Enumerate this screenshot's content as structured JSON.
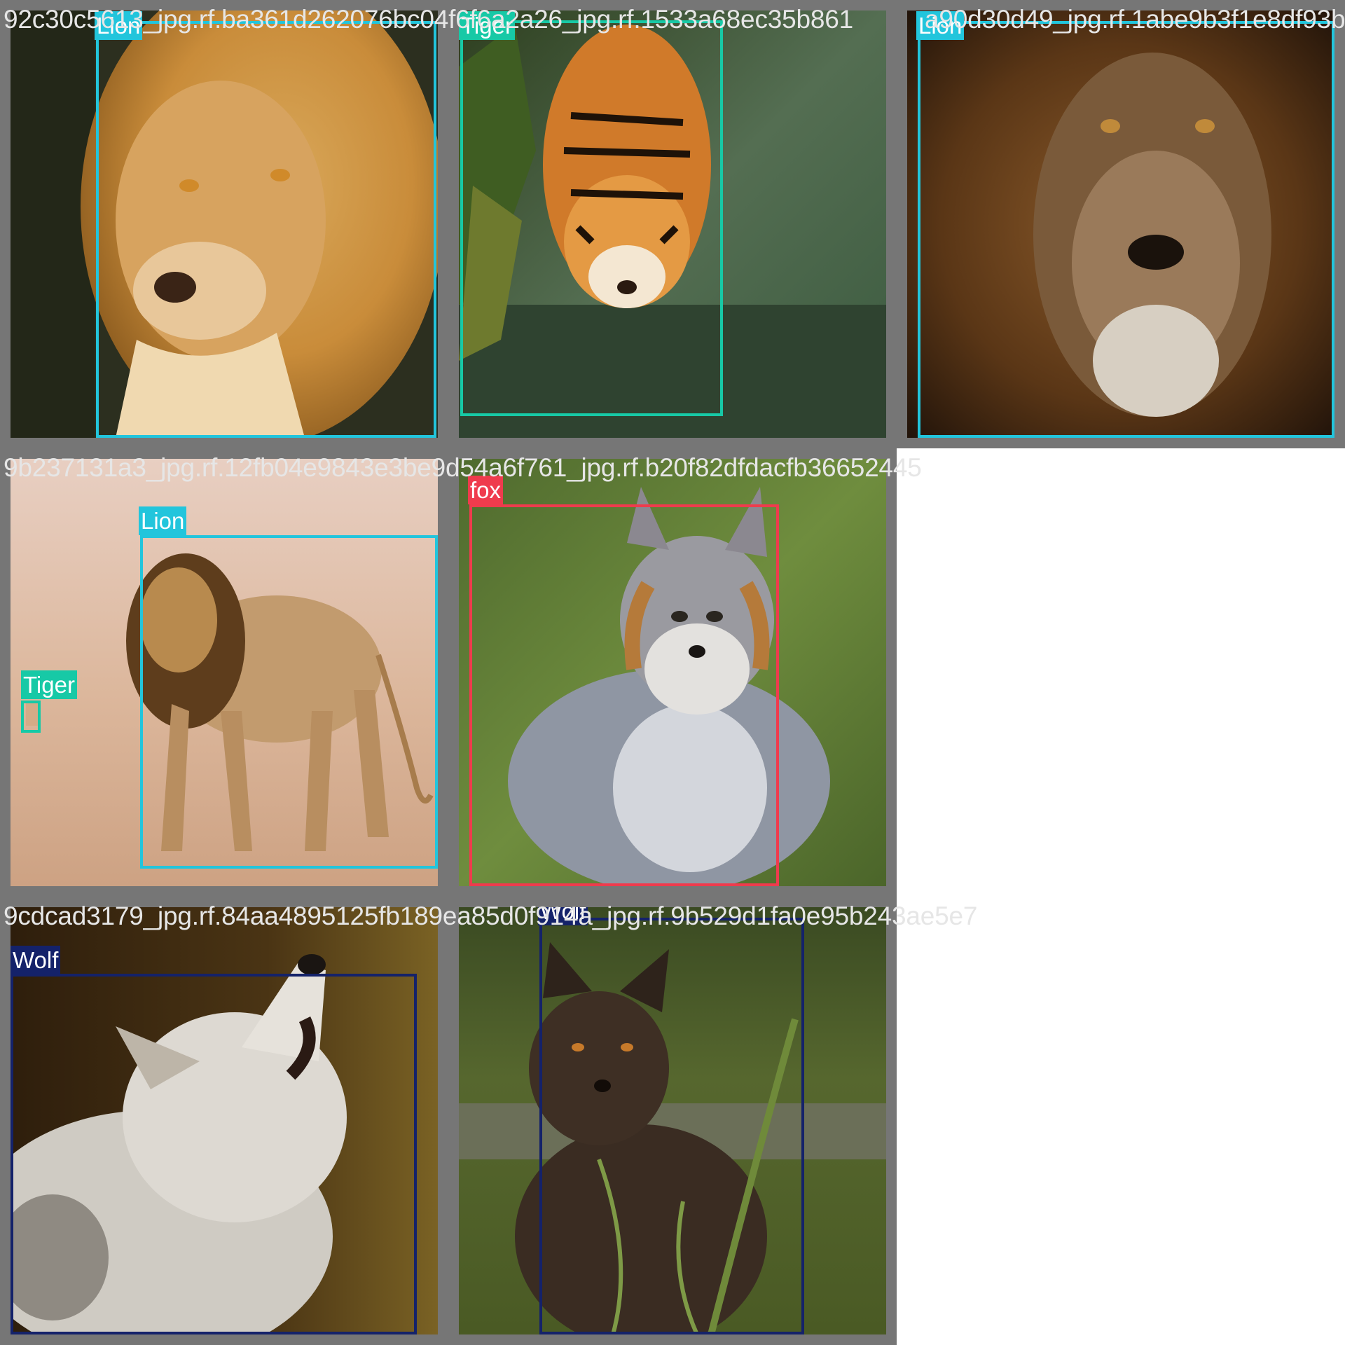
{
  "class_colors": {
    "Lion": "#22c5dc",
    "Tiger": "#17c9a6",
    "fox": "#ef3b4d",
    "Wolf": "#14226a"
  },
  "tiles": [
    {
      "filename": "92c30c5613_jpg.rf.ba361d262076bc04f6f6a2a26_jpg.rf.1533a68ec35b861",
      "scene": "lion-closeup",
      "boxes": [
        {
          "label": "Lion"
        }
      ]
    },
    {
      "filename": "",
      "scene": "tiger-stream",
      "boxes": [
        {
          "label": "Tiger"
        }
      ]
    },
    {
      "filename": "a90d30d49_jpg.rf.1abe9b3f1e8df93b",
      "scene": "lion-dark",
      "boxes": [
        {
          "label": "Lion"
        }
      ]
    },
    {
      "filename": "9b237131a3_jpg.rf.12fb04e9843e3be9d54a6f761_jpg.rf.b20f82dfdacfb36652445",
      "scene": "lion-walking",
      "boxes": [
        {
          "label": "Lion"
        },
        {
          "label": "Tiger"
        }
      ]
    },
    {
      "filename": "",
      "scene": "grey-fox",
      "boxes": [
        {
          "label": "fox"
        }
      ]
    },
    {
      "filename": "9cdcad3179_jpg.rf.84aa4895125fb189ea85d0f914a_jpg.rf.9b529d1fa0e95b243ae5e7",
      "scene": "wolf-howling",
      "boxes": [
        {
          "label": "Wolf"
        }
      ]
    },
    {
      "filename": "",
      "scene": "dark-fox",
      "boxes": [
        {
          "label": "Wolf"
        }
      ]
    }
  ]
}
